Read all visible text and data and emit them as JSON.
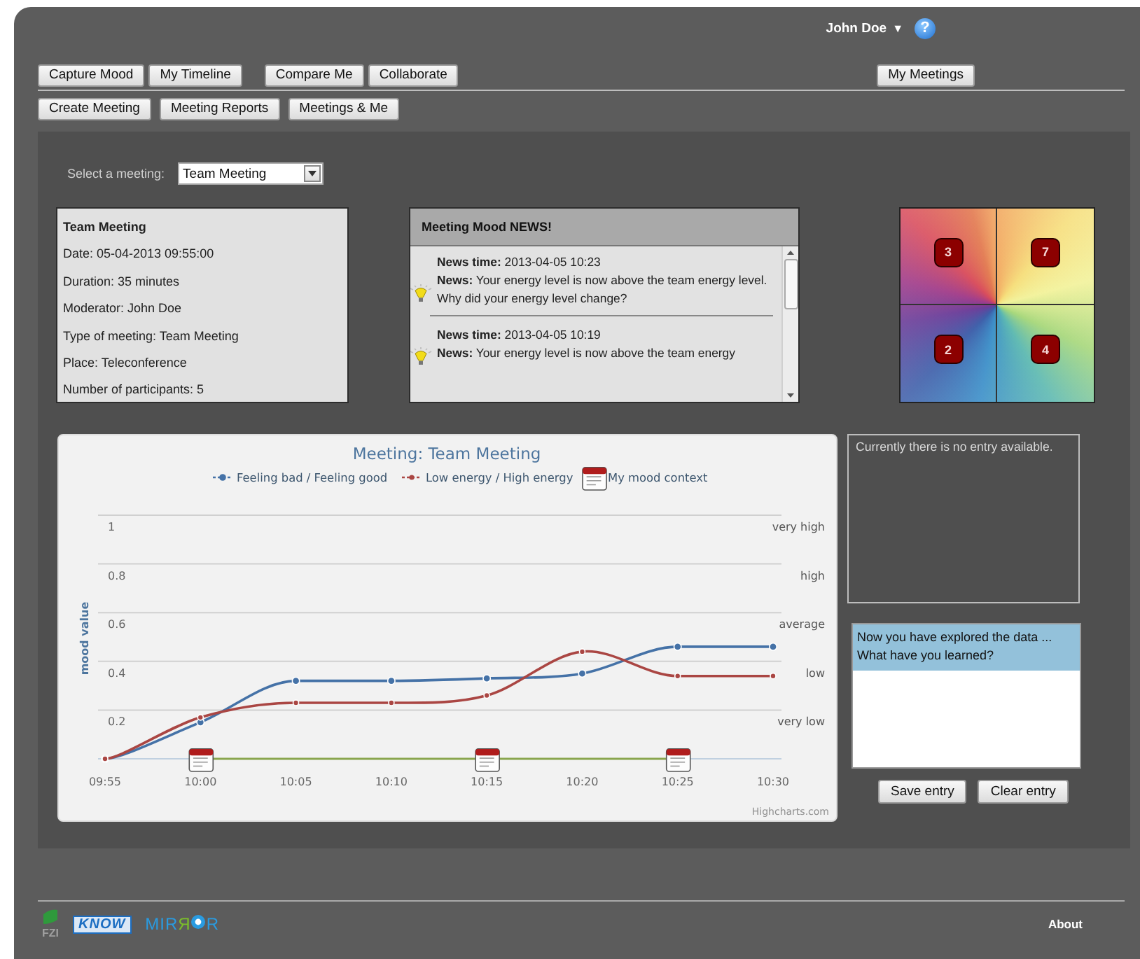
{
  "user": {
    "name": "John Doe",
    "caret": "▼",
    "help": "?"
  },
  "nav_row_1": [
    [
      "Capture Mood",
      "My Timeline"
    ],
    [
      "Compare Me",
      "Collaborate"
    ]
  ],
  "nav_row_1_right": [
    "My Meetings"
  ],
  "nav_row_2": [
    "Create Meeting",
    "Meeting Reports",
    "Meetings & Me"
  ],
  "meeting_select": {
    "label": "Select a meeting:",
    "value": "Team Meeting"
  },
  "meeting_info": {
    "title": "Team Meeting",
    "lines": [
      "Date: 05-04-2013 09:55:00",
      "Duration: 35 minutes",
      "Moderator: John Doe",
      "Type of meeting: Team Meeting",
      "Place: Teleconference",
      "Number of participants: 5"
    ]
  },
  "news": {
    "title": "Meeting Mood NEWS!",
    "items": [
      {
        "lines": [
          "**News time:** 2013-04-05 10:23",
          "**News:** Your energy level is now above the team energy level.",
          "Why did your energy level change?"
        ]
      },
      {
        "lines": [
          "**News time:** 2013-04-05 10:19",
          "**News:** Your energy level is now above the team energy"
        ]
      }
    ]
  },
  "mood_quadrants": [
    {
      "count": "3"
    },
    {
      "count": "7"
    },
    {
      "count": "2"
    },
    {
      "count": "4"
    }
  ],
  "chart": {
    "credit": "Highcharts.com",
    "right_axis_labels": [
      {
        "value": "1",
        "label": "very high"
      },
      {
        "value": "0.8",
        "label": "high"
      },
      {
        "value": "0.6",
        "label": "average"
      },
      {
        "value": "0.4",
        "label": "low"
      },
      {
        "value": "0.2",
        "label": "very low"
      }
    ],
    "chart_data": {
      "type": "line",
      "grid": true,
      "legend": "top",
      "title": "Meeting: Team Meeting",
      "ylabel": "mood value",
      "categories": [
        "09:55",
        "10:00",
        "10:05",
        "10:10",
        "10:15",
        "10:20",
        "10:25",
        "10:30"
      ],
      "series": [
        {
          "name": "Feeling bad / Feeling good",
          "color": "#4572a7",
          "marker": "circle",
          "values": [
            0,
            0.15,
            0.32,
            0.32,
            0.33,
            0.35,
            0.46,
            0.46
          ]
        },
        {
          "name": "Low energy / High energy",
          "color": "#aa4643",
          "marker": "circle",
          "values": [
            0,
            0.17,
            0.23,
            0.23,
            0.26,
            0.44,
            0.34,
            0.34
          ]
        },
        {
          "name": "My mood context",
          "color": "#89a54e",
          "marker": "square",
          "values": [
            null,
            0,
            null,
            null,
            0,
            null,
            0,
            null
          ]
        }
      ],
      "ylim": [
        0,
        1
      ],
      "yticks": [
        0.2,
        0.4,
        0.6,
        0.8,
        1
      ]
    }
  },
  "journal": {
    "empty_text": "Currently there is no entry available."
  },
  "reflection": {
    "prompt_lines": [
      "Now you have explored the data ...",
      "What have you learned?"
    ]
  },
  "entry_buttons": [
    "Save entry",
    "Clear entry"
  ],
  "footer": {
    "fzi": "FZI",
    "know": "KNOW",
    "mirror_left": "MIR",
    "mirror_flipped": "Я",
    "mirror_right": "R",
    "about": "About"
  }
}
